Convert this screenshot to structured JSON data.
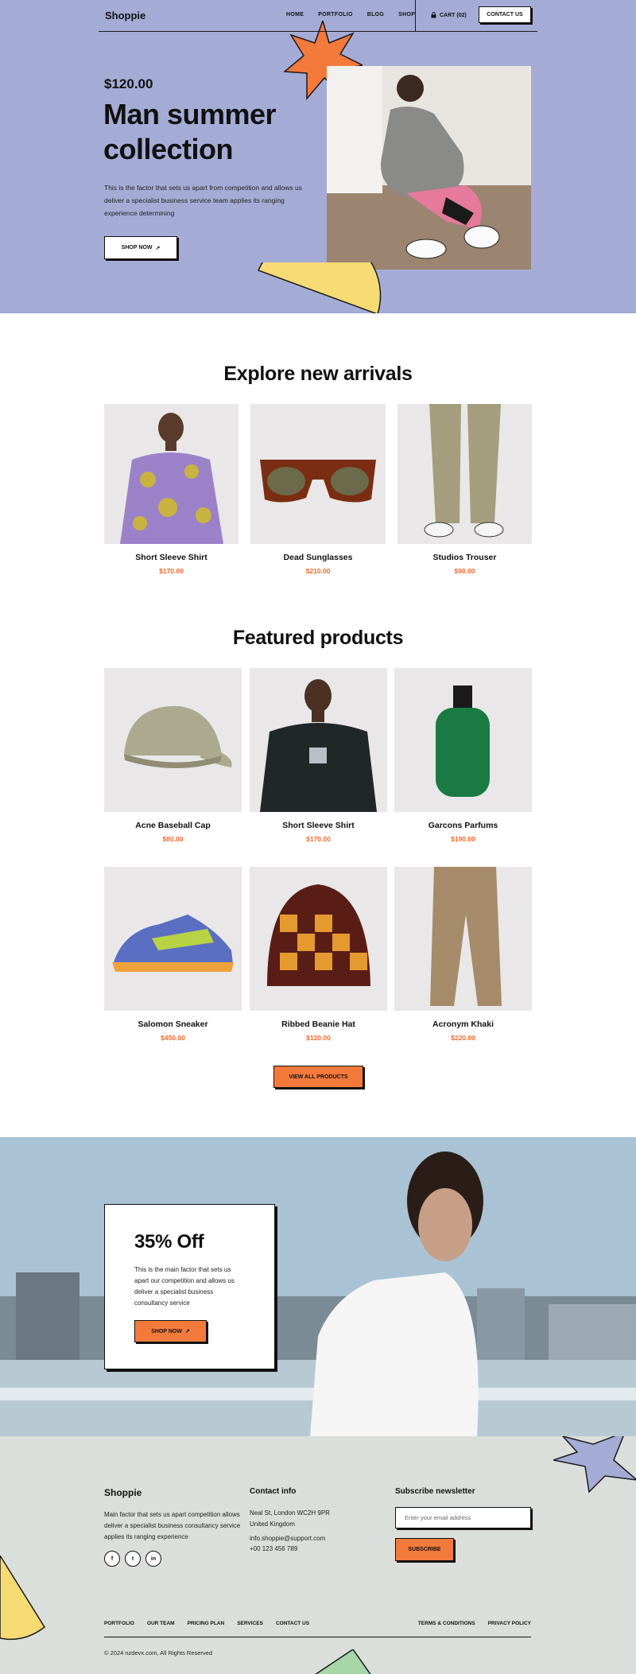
{
  "nav": {
    "logo": "Shoppie",
    "links": [
      "HOME",
      "PORTFOLIO",
      "BLOG",
      "SHOP"
    ],
    "cart": "CART (02)",
    "contact": "CONTACT US"
  },
  "hero": {
    "price": "$120.00",
    "title": "Man summer collection",
    "description": "This is the factor that sets us apart from competition and allows us deliver a specialist business service team applies its ranging experience determining",
    "button": "SHOP NOW"
  },
  "arrivals": {
    "title": "Explore new arrivals",
    "items": [
      {
        "name": "Short Sleeve Shirt",
        "price": "$170.00",
        "image": "floral-shirt-model"
      },
      {
        "name": "Dead Sunglasses",
        "price": "$210.00",
        "image": "tortoise-sunglasses"
      },
      {
        "name": "Studios Trouser",
        "price": "$90.00",
        "image": "khaki-trouser"
      }
    ]
  },
  "featured": {
    "title": "Featured products",
    "items": [
      {
        "name": "Acne Baseball Cap",
        "price": "$80.00",
        "image": "baseball-cap"
      },
      {
        "name": "Short Sleeve Shirt",
        "price": "$170.00",
        "image": "black-tshirt-model"
      },
      {
        "name": "Garcons Parfums",
        "price": "$190.00",
        "image": "green-perfume"
      },
      {
        "name": "Salomon Sneaker",
        "price": "$450.00",
        "image": "sneaker"
      },
      {
        "name": "Ribbed Beanie Hat",
        "price": "$120.00",
        "image": "beanie"
      },
      {
        "name": "Acronym Khaki",
        "price": "$220.00",
        "image": "khaki-pants"
      }
    ],
    "button": "VIEW ALL PRODUCTS"
  },
  "promo": {
    "title": "35% Off",
    "description": "This is the main factor that sets us apart our competition and allows us deliver a specialist business consultancy service",
    "button": "SHOP NOW"
  },
  "footer": {
    "logo": "Shoppie",
    "description": "Main factor that sets us apart competition allows deliver a specialist business consultancy service applies its ranging experience",
    "socials": [
      "facebook-icon",
      "twitter-icon",
      "linkedin-icon"
    ],
    "contact_title": "Contact info",
    "address": "Neal St, London WC2H 9PR United Kingdom",
    "email": "info.shoppie@support.com",
    "phone": "+00 123 456 789",
    "newsletter_title": "Subscribe newsletter",
    "email_placeholder": "Enter your email address",
    "subscribe": "SUBSCRIBE",
    "links": [
      "PORTFOLIO",
      "OUR TEAM",
      "PRICING PLAN",
      "SERVICES",
      "CONTACT US"
    ],
    "legal": [
      "TERMS & CONDITIONS",
      "PRIVACY POLICY"
    ],
    "copyright": "© 2024 nzdevx.com, All Rights Reserved"
  },
  "colors": {
    "hero_bg": "#a4acd6",
    "accent": "#f47a3c",
    "price": "#f26a2e",
    "footer_bg": "#dadfdb",
    "yellow": "#f6da74"
  }
}
